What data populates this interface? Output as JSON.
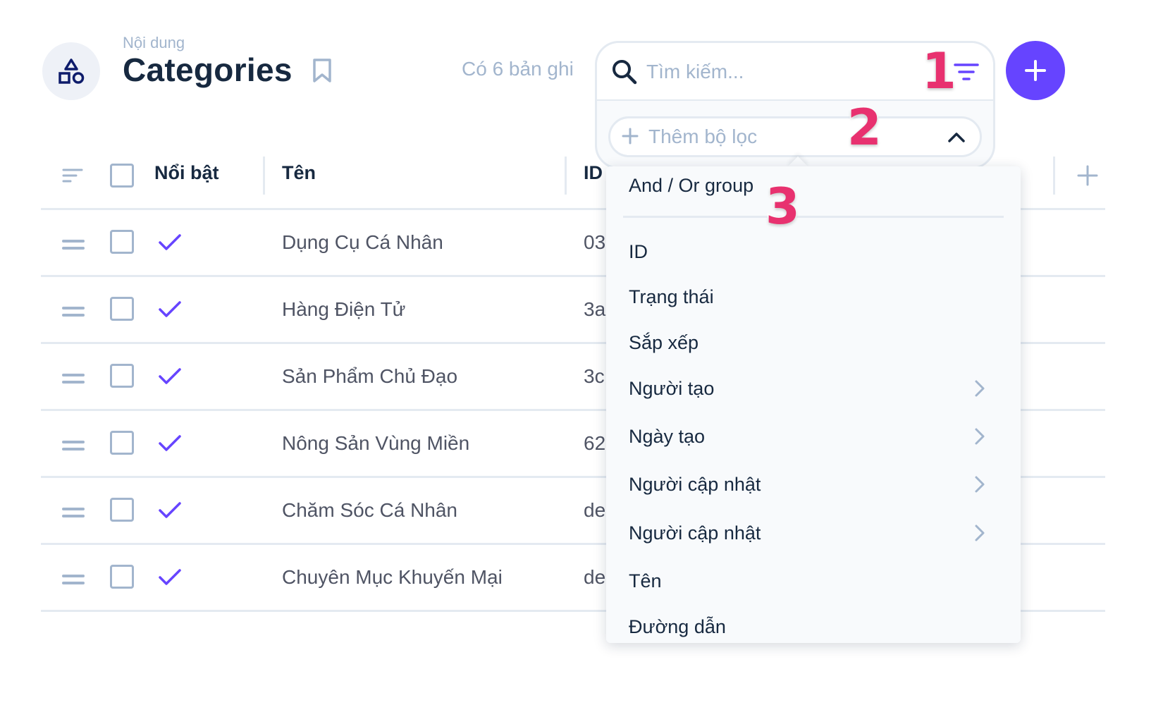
{
  "header": {
    "breadcrumb": "Nội dung",
    "title": "Categories",
    "record_count": "Có 6 bản ghi"
  },
  "search": {
    "placeholder": "Tìm kiếm...",
    "add_filter_label": "Thêm bộ lọc"
  },
  "markers": [
    "1",
    "2",
    "3"
  ],
  "table": {
    "columns": [
      "Nổi bật",
      "Tên",
      "ID"
    ],
    "rows": [
      {
        "featured": true,
        "name": "Dụng Cụ Cá Nhân",
        "id": "03"
      },
      {
        "featured": true,
        "name": "Hàng Điện Tử",
        "id": "3a"
      },
      {
        "featured": true,
        "name": "Sản Phẩm Chủ Đạo",
        "id": "3c"
      },
      {
        "featured": true,
        "name": "Nông Sản Vùng Miền",
        "id": "62"
      },
      {
        "featured": true,
        "name": "Chăm Sóc Cá Nhân",
        "id": "de"
      },
      {
        "featured": true,
        "name": "Chuyên Mục Khuyến Mại",
        "id": "de"
      }
    ]
  },
  "filter_menu": {
    "group_label": "And / Or group",
    "items": [
      {
        "label": "ID",
        "has_submenu": false
      },
      {
        "label": "Trạng thái",
        "has_submenu": false
      },
      {
        "label": "Sắp xếp",
        "has_submenu": false
      },
      {
        "label": "Người tạo",
        "has_submenu": true
      },
      {
        "label": "Ngày tạo",
        "has_submenu": true
      },
      {
        "label": "Người cập nhật",
        "has_submenu": true
      },
      {
        "label": "Người cập nhật",
        "has_submenu": true
      },
      {
        "label": "Tên",
        "has_submenu": false
      },
      {
        "label": "Đường dẫn",
        "has_submenu": false
      }
    ]
  },
  "colors": {
    "accent": "#6644ff",
    "marker": "#e8316f",
    "muted": "#a2b5cd",
    "border": "#e4eaf1",
    "text": "#172940"
  },
  "icons": [
    "category-icon",
    "bookmark-icon",
    "search-icon",
    "filter-icon",
    "plus-icon",
    "chevron-up-icon",
    "sort-icon",
    "drag-handle-icon",
    "check-icon",
    "chevron-right-icon"
  ]
}
